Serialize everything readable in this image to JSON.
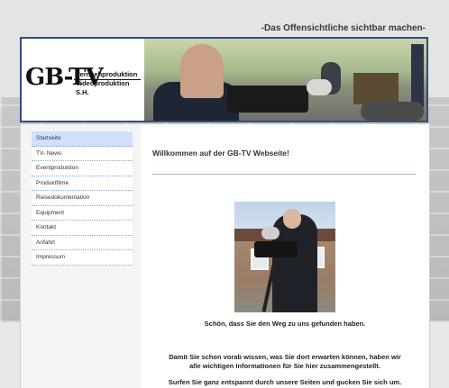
{
  "tagline": "-Das Offensichtliche sichtbar machen-",
  "logo": {
    "mark": "GB-TV",
    "line1": "Fernsehproduktion",
    "line2": "Videoproduktion S.H."
  },
  "nav": {
    "items": [
      {
        "label": "Startseite",
        "active": true
      },
      {
        "label": "TV- News"
      },
      {
        "label": "Eventproduktion"
      },
      {
        "label": "Produktfilme"
      },
      {
        "label": "Reisedokumentation"
      },
      {
        "label": "Equipment"
      },
      {
        "label": "Kontakt"
      },
      {
        "label": "Anfahrt"
      },
      {
        "label": "Impressum"
      }
    ]
  },
  "main": {
    "heading": "Willkommen auf der GB-TV Webseite!",
    "p1": "Schön, dass Sie den Weg zu uns gefunden haben.",
    "p2_line1": "Damit Sie schon vorab wissen, was Sie dort erwarten können, haben wir",
    "p2_line2": "alle wichtigen Informationen für Sie hier zusammengestellt.",
    "p3": "Surfen Sie ganz entspannt durch unsere Seiten und gucken Sie sich um."
  },
  "colors": {
    "accent": "#2e4f86",
    "nav_active_bg": "#cfe0f8"
  }
}
